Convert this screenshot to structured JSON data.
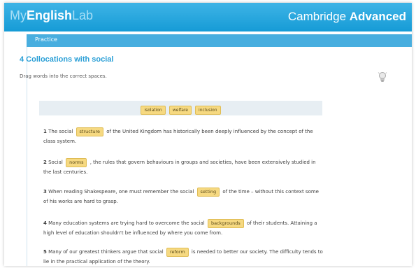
{
  "header": {
    "brand_part1": "My",
    "brand_part2": "English",
    "brand_part3": "Lab",
    "product_part1": "Cambridge ",
    "product_part2": "Advanced"
  },
  "subnav": {
    "label": "Practice"
  },
  "exercise": {
    "title": "4 Collocations with social",
    "instruction": "Drag words into the correct spaces.",
    "word_bank": [
      "isolation",
      "welfare",
      "inclusion"
    ]
  },
  "questions": [
    {
      "num": "1",
      "before": " The social ",
      "answer": "structure",
      "after": " of the United Kingdom has historically been deeply influenced by the concept of the class system."
    },
    {
      "num": "2",
      "before": " Social ",
      "answer": "norms",
      "after": " , the rules that govern behaviours in groups and societies, have been extensively studied in the last centuries."
    },
    {
      "num": "3",
      "before": " When reading Shakespeare, one must remember the social ",
      "answer": "setting",
      "after": " of the time – without this context some of his works are hard to grasp."
    },
    {
      "num": "4",
      "before": " Many education systems are trying hard to overcome the social ",
      "answer": "backgrounds",
      "after": " of their students. Attaining a high level of education shouldn't be influenced by where you come from."
    },
    {
      "num": "5",
      "before": " Many of our greatest thinkers argue that social ",
      "answer": "reform",
      "after": " is needed to better our society. The difficulty tends to lie in the practical application of the theory."
    }
  ],
  "colors": {
    "header_bg": "#169bd6",
    "accent": "#2a9fd6",
    "chip_bg": "#f6d981",
    "wordbank_bg": "#e7eef3"
  },
  "icons": {
    "hint": "lightbulb-icon"
  }
}
